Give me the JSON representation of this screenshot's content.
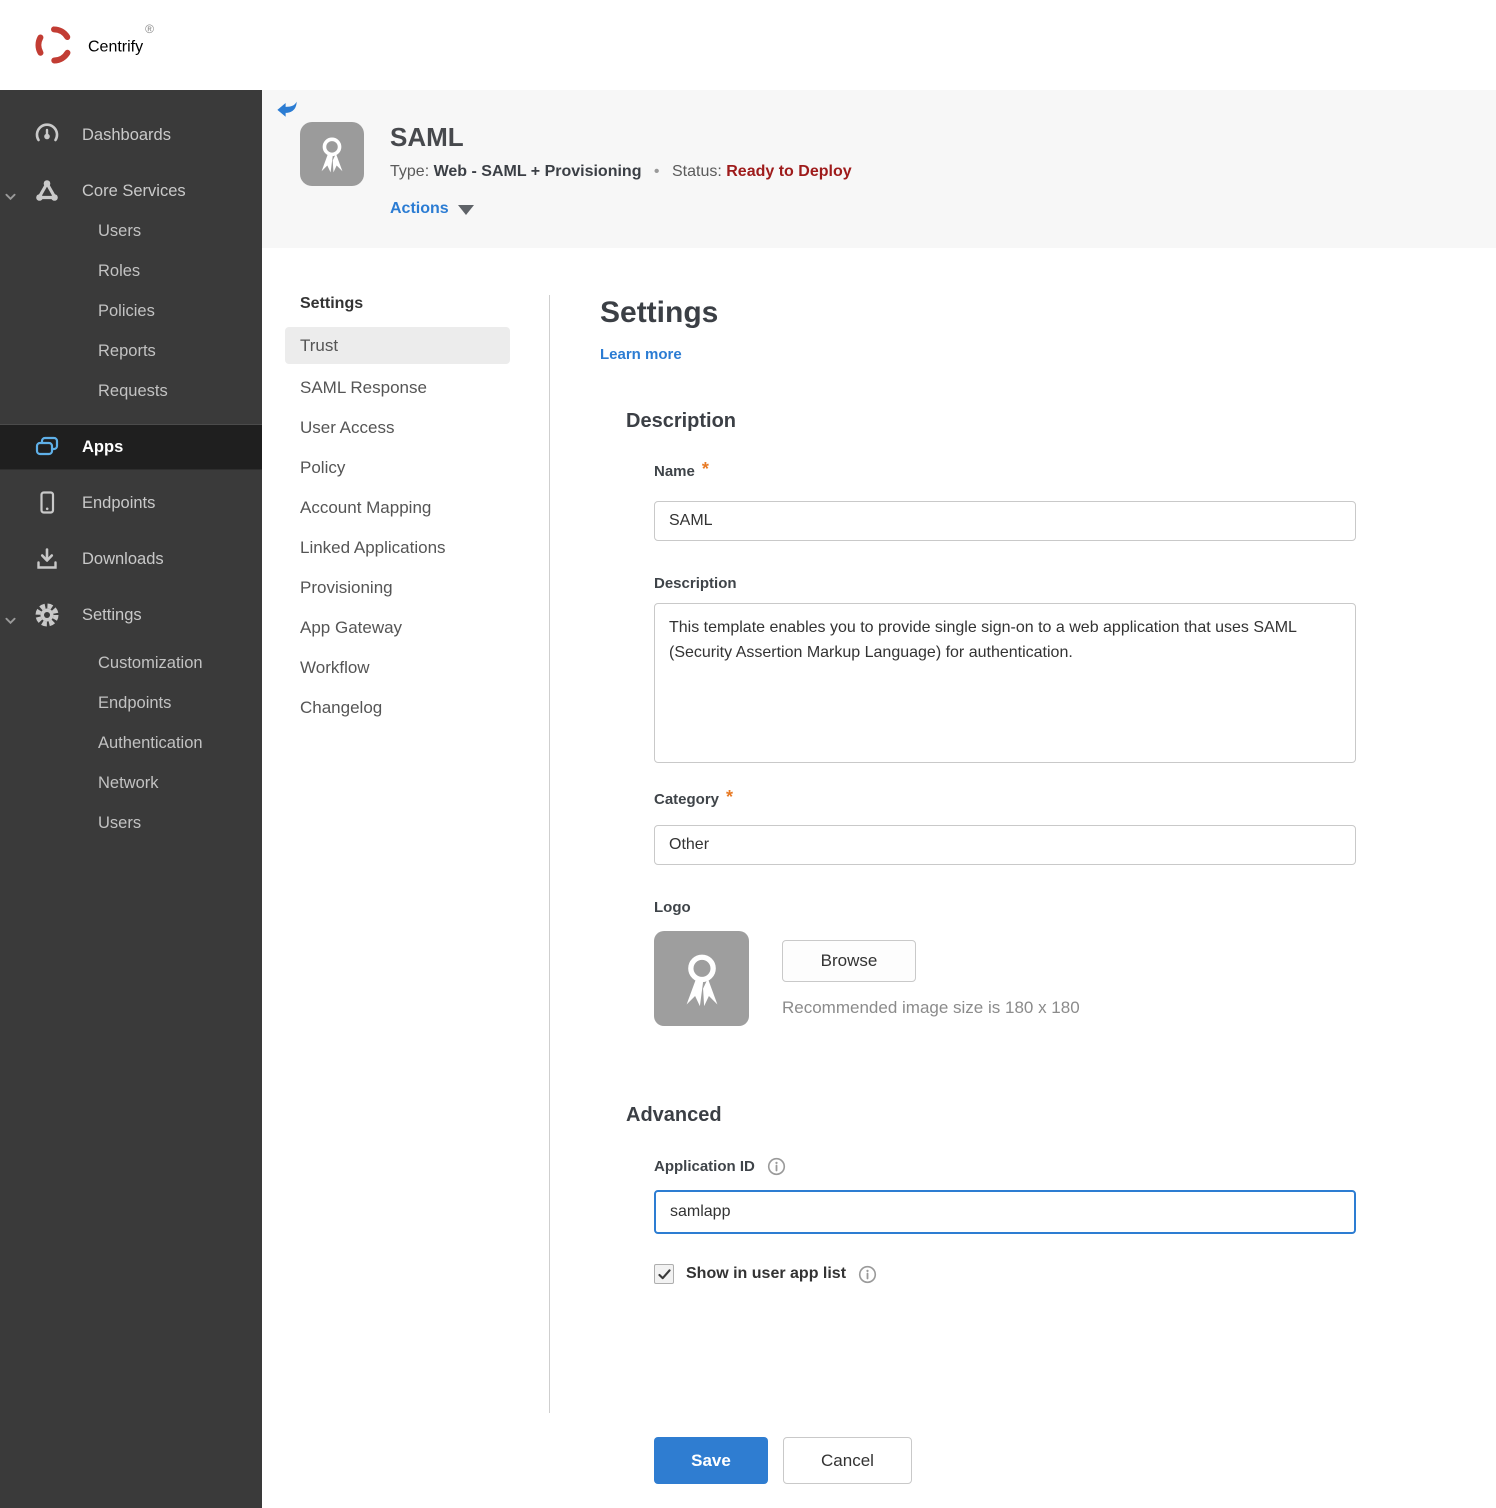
{
  "brand": {
    "name": "Centrify",
    "mark": "®"
  },
  "sidebar": {
    "dashboards_label": "Dashboards",
    "core_services_label": "Core Services",
    "core_services_children": [
      "Users",
      "Roles",
      "Policies",
      "Reports",
      "Requests"
    ],
    "apps_label": "Apps",
    "endpoints_label": "Endpoints",
    "downloads_label": "Downloads",
    "settings_label": "Settings",
    "settings_children": [
      "Customization",
      "Endpoints",
      "Authentication",
      "Network",
      "Users"
    ]
  },
  "app_header": {
    "title": "SAML",
    "type_label": "Type:",
    "type_value": "Web - SAML + Provisioning",
    "dot": "•",
    "status_label": "Status:",
    "status_value": "Ready to Deploy",
    "actions_label": "Actions"
  },
  "subnav": {
    "title": "Settings",
    "selected": "Trust",
    "items": [
      "Trust",
      "SAML Response",
      "User Access",
      "Policy",
      "Account Mapping",
      "Linked Applications",
      "Provisioning",
      "App Gateway",
      "Workflow",
      "Changelog"
    ]
  },
  "main": {
    "title": "Settings",
    "learn_more": "Learn more",
    "description_title": "Description",
    "required_marker": "*",
    "name_label": "Name",
    "name_value": "SAML",
    "desc_label": "Description",
    "desc_value": "This template enables you to provide single sign-on to a web application that uses SAML (Security Assertion Markup Language) for authentication.",
    "category_label": "Category",
    "category_value": "Other",
    "logo_label": "Logo",
    "browse_label": "Browse",
    "logo_hint": "Recommended image size is 180 x 180",
    "advanced_title": "Advanced",
    "app_id_label": "Application ID",
    "app_id_value": "samlapp",
    "show_label": "Show in user app list",
    "show_checked": true,
    "save_label": "Save",
    "cancel_label": "Cancel"
  },
  "colors": {
    "accent_blue": "#2b7cd3",
    "status_red": "#9e1b1b",
    "asterisk_orange": "#e87a24",
    "save_blue": "#2f7dd1",
    "apps_icon_blue": "#5fb0e8",
    "sidebar_bg": "#3a3a3a",
    "header_bg": "#f7f7f7"
  }
}
